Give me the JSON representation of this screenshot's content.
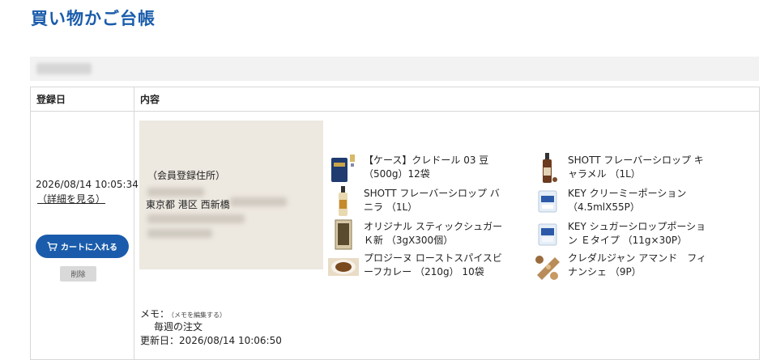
{
  "page": {
    "title": "買い物かご台帳"
  },
  "table": {
    "headers": {
      "date": "登録日",
      "content": "内容"
    },
    "rows": [
      {
        "registered_at": "2026/08/14 10:05:34",
        "detail_link": "（詳細を見る）",
        "add_to_cart": "カートに入れる",
        "delete": "削除",
        "address": {
          "label": "（会員登録住所）",
          "city": "東京都 港区 西新橋"
        },
        "memo": {
          "label": "メモ：",
          "edit_link": "（メモを編集する）",
          "text": "毎週の注文",
          "updated": "更新日：2026/08/14 10:06:50"
        },
        "products": [
          {
            "name": "【ケース】クレドール 03 豆 （500g）12袋",
            "icon": "coffee-bag-icon"
          },
          {
            "name": "SHOTT フレーバーシロップ キャラメル （1L）",
            "icon": "syrup-bottle-icon"
          },
          {
            "name": "SHOTT フレーバーシロップ バニラ （1L）",
            "icon": "syrup-bottle-icon"
          },
          {
            "name": "KEY クリーミーポーション （4.5mlX55P）",
            "icon": "creamer-pack-icon"
          },
          {
            "name": "オリジナル スティックシュガー Ｋ新 （3gX300個）",
            "icon": "sugar-box-icon"
          },
          {
            "name": "KEY シュガーシロップポーション Ｅタイプ （11g×30P）",
            "icon": "syrup-pack-icon"
          },
          {
            "name": "プロジーヌ ローストスパイスビーフカレー （210g） 10袋",
            "icon": "curry-plate-icon"
          },
          {
            "name": "クレダルジャン アマンド　フィナンシェ （9P）",
            "icon": "financier-icon"
          }
        ]
      }
    ]
  },
  "colors": {
    "accent": "#1a5cab",
    "address_bg": "#ede8e0"
  }
}
